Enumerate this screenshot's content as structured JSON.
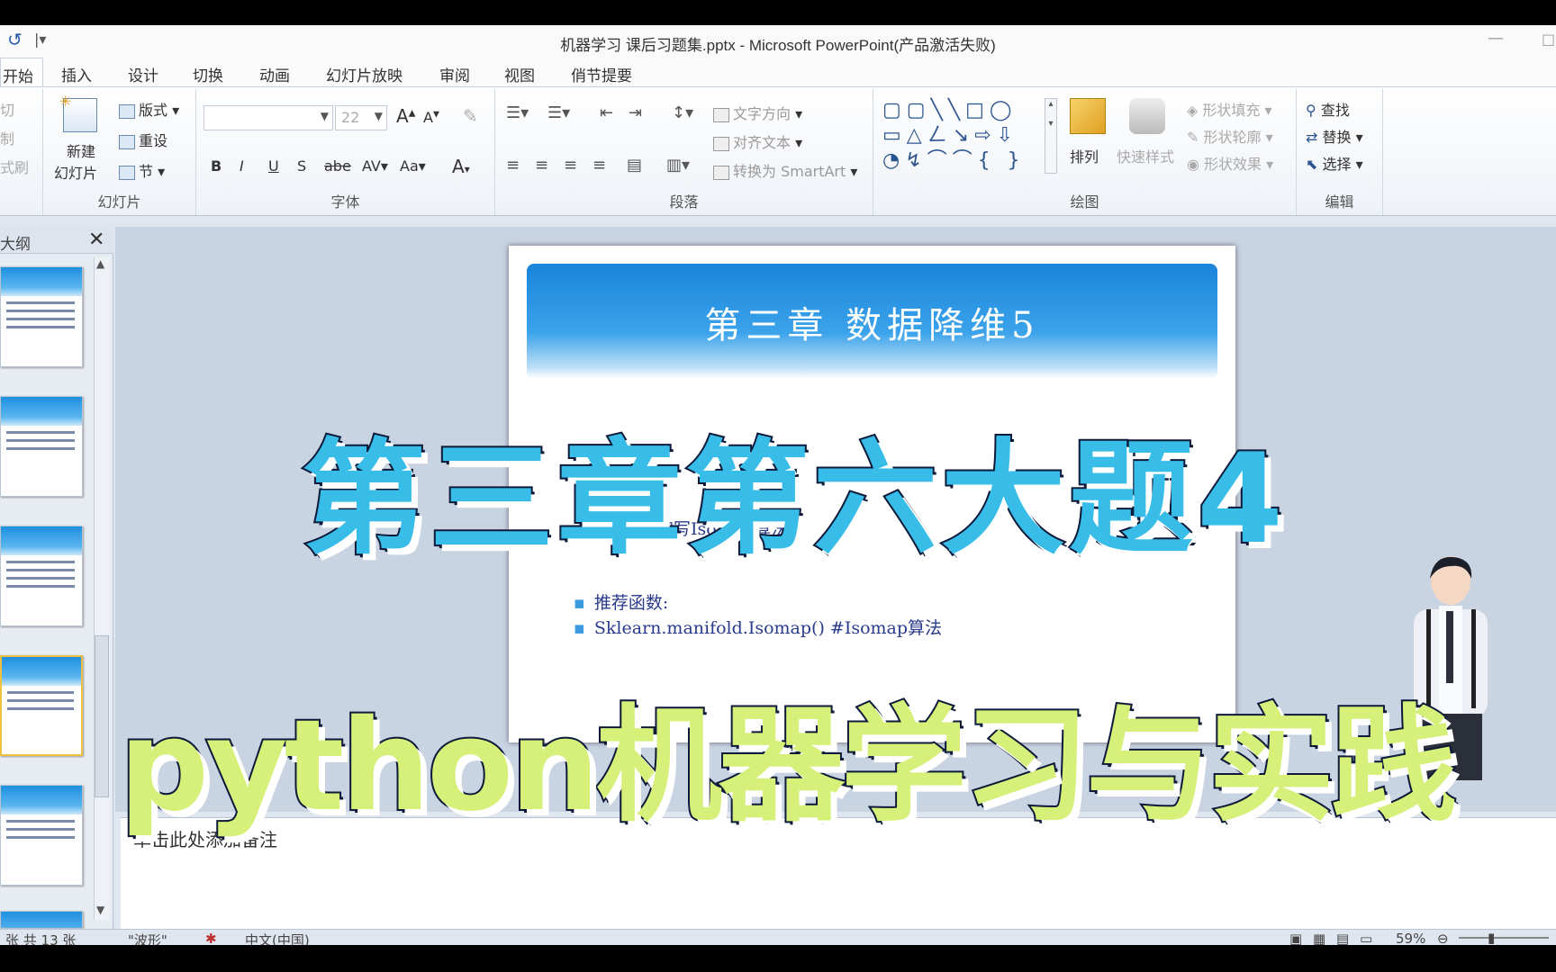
{
  "window": {
    "title": "机器学习 课后习题集.pptx - Microsoft PowerPoint(产品激活失败)"
  },
  "tabs": [
    {
      "label": "开始",
      "active": true
    },
    {
      "label": "插入"
    },
    {
      "label": "设计"
    },
    {
      "label": "切换"
    },
    {
      "label": "动画"
    },
    {
      "label": "幻灯片放映"
    },
    {
      "label": "审阅"
    },
    {
      "label": "视图"
    },
    {
      "label": "俏节提要"
    }
  ],
  "ribbon": {
    "clipboard": {
      "cut": "切",
      "copy": "制",
      "painter": "式刷"
    },
    "slides": {
      "new_slide_1": "新建",
      "new_slide_2": "幻灯片",
      "layout": "版式",
      "reset": "重设",
      "section": "节",
      "label": "幻灯片"
    },
    "font": {
      "size": "22",
      "bold": "B",
      "italic": "I",
      "underline": "U",
      "strike": "S",
      "shadow": "abe",
      "spacing": "AV",
      "case": "Aa",
      "color": "A",
      "grow": "A",
      "shrink": "A",
      "label": "字体"
    },
    "paragraph": {
      "text_direction": "文字方向",
      "align_text": "对齐文本",
      "smartart": "转换为 SmartArt",
      "label": "段落"
    },
    "drawing": {
      "arrange": "排列",
      "quick_styles": "快速样式",
      "shape_fill": "形状填充",
      "shape_outline": "形状轮廓",
      "shape_effects": "形状效果",
      "label": "绘图"
    },
    "editing": {
      "find": "查找",
      "replace": "替换",
      "select": "选择",
      "label": "编辑"
    }
  },
  "leftpane": {
    "tab_label": "大纲",
    "close": "✕"
  },
  "slide": {
    "title": "第三章 数据降维5",
    "bullets": [
      "4、自己编写Isomap算法",
      "推荐函数:",
      "Sklearn.manifold.Isomap()    #Isomap算法"
    ]
  },
  "overlay": {
    "caption_top": "第三章第六大题4",
    "caption_bottom": "python机器学习与实践"
  },
  "notes": {
    "placeholder": "单击此处添加备注"
  },
  "status": {
    "slide_of": "张  共 13 张",
    "theme": "\"波形\"",
    "language": "中文(中国)",
    "zoom": "59%"
  }
}
